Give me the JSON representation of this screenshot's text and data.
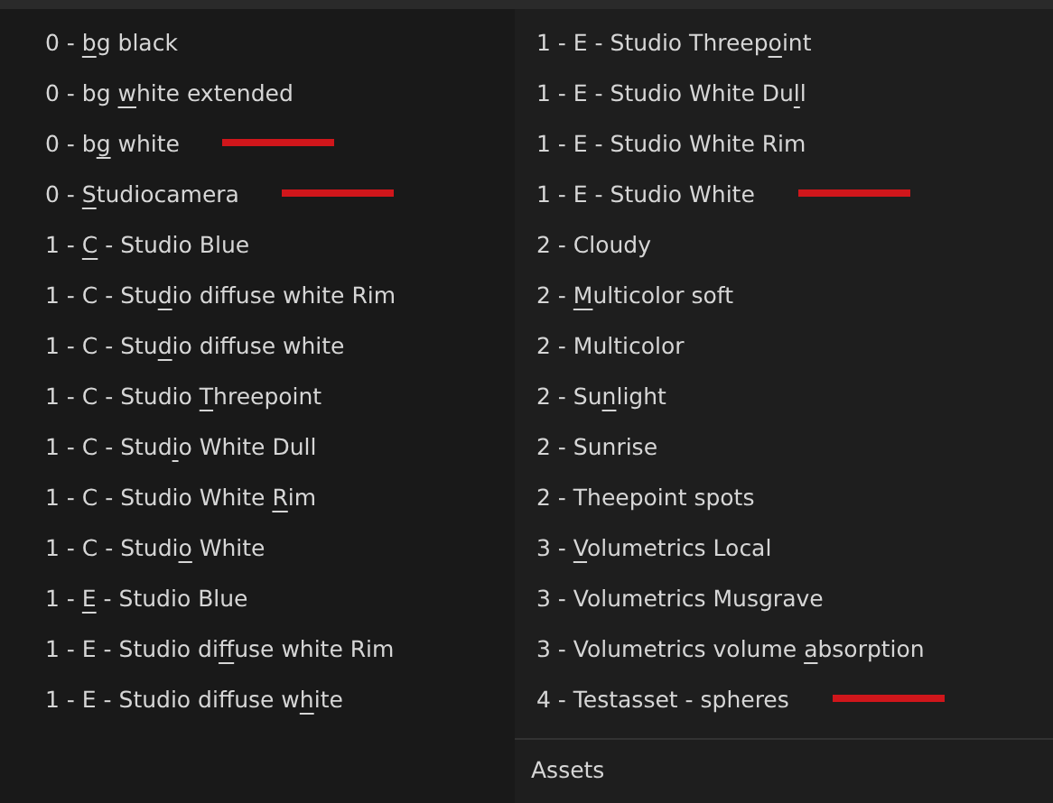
{
  "menu": {
    "columns": [
      {
        "items": [
          {
            "before": "0 - ",
            "key": "b",
            "after": "g black",
            "marked": false
          },
          {
            "before": "0 - bg ",
            "key": "w",
            "after": "hite extended",
            "marked": false
          },
          {
            "before": "0 - b",
            "key": "g",
            "after": " white",
            "marked": true
          },
          {
            "before": "0 - ",
            "key": "S",
            "after": "tudiocamera",
            "marked": true
          },
          {
            "before": "1 - ",
            "key": "C",
            "after": " - Studio Blue",
            "marked": false
          },
          {
            "before": "1 - C - Stu",
            "key": "d",
            "after": "io diffuse white Rim",
            "marked": false
          },
          {
            "before": "1 - C - Stu",
            "key": "d",
            "after": "io diffuse white",
            "marked": false
          },
          {
            "before": "1 - C - Studio ",
            "key": "T",
            "after": "hreepoint",
            "marked": false
          },
          {
            "before": "1 - C - Stud",
            "key": "i",
            "after": "o White Dull",
            "marked": false
          },
          {
            "before": "1 - C - Studio White ",
            "key": "R",
            "after": "im",
            "marked": false
          },
          {
            "before": "1 - C - Studi",
            "key": "o",
            "after": " White",
            "marked": false
          },
          {
            "before": "1 - ",
            "key": "E",
            "after": " - Studio Blue",
            "marked": false
          },
          {
            "before": "1 - E - Studio di",
            "key": "f",
            "after": "fuse white Rim",
            "marked": false
          },
          {
            "before": "1 - E - Studio diffuse w",
            "key": "h",
            "after": "ite",
            "marked": false
          }
        ]
      },
      {
        "items": [
          {
            "before": "1 - E - Studio Threep",
            "key": "o",
            "after": "int",
            "marked": false
          },
          {
            "before": "1 - E - Studio White Du",
            "key": "l",
            "after": "l",
            "marked": false
          },
          {
            "before": "1 - E - Studio White Rim",
            "marked": false
          },
          {
            "before": "1 - E - Studio White",
            "marked": true
          },
          {
            "before": "2 - Cloudy",
            "marked": false
          },
          {
            "before": "2 - ",
            "key": "M",
            "after": "ulticolor soft",
            "marked": false
          },
          {
            "before": "2 - Multicolor",
            "marked": false
          },
          {
            "before": "2 - Su",
            "key": "n",
            "after": "light",
            "marked": false
          },
          {
            "before": "2 - Sunrise",
            "marked": false
          },
          {
            "before": "2 - Theepoint spots",
            "marked": false
          },
          {
            "before": "3 - ",
            "key": "V",
            "after": "olumetrics Local",
            "marked": false
          },
          {
            "before": "3 - Volumetrics Musgrave",
            "marked": false
          },
          {
            "before": "3 - Volumetrics volume ",
            "key": "a",
            "after": "bsorption",
            "marked": false
          },
          {
            "before": "4 - Testasset - spheres",
            "marked": true
          }
        ]
      }
    ],
    "footer": "Assets"
  }
}
